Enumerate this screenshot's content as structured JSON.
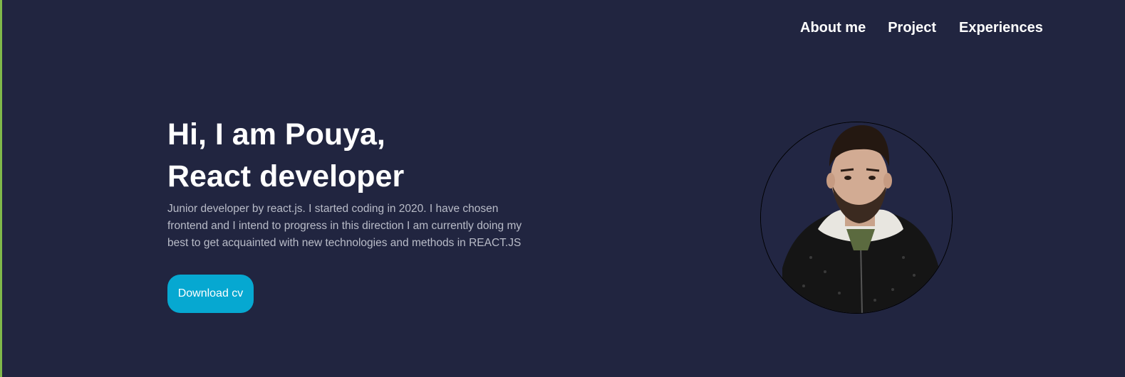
{
  "nav": {
    "items": [
      {
        "label": "About me"
      },
      {
        "label": "Project"
      },
      {
        "label": "Experiences"
      }
    ]
  },
  "hero": {
    "title_line1": "Hi, I am Pouya,",
    "title_line2": "React developer",
    "description": "Junior developer by react.js. I started coding in 2020. I have chosen frontend and I intend to progress in this direction I am currently doing my best to get acquainted with new technologies and methods in REACT.JS",
    "download_label": "Download cv"
  },
  "colors": {
    "background": "#212540",
    "accent_button": "#06a8d1",
    "text_primary": "#ffffff",
    "text_secondary": "#b9bcc8"
  }
}
